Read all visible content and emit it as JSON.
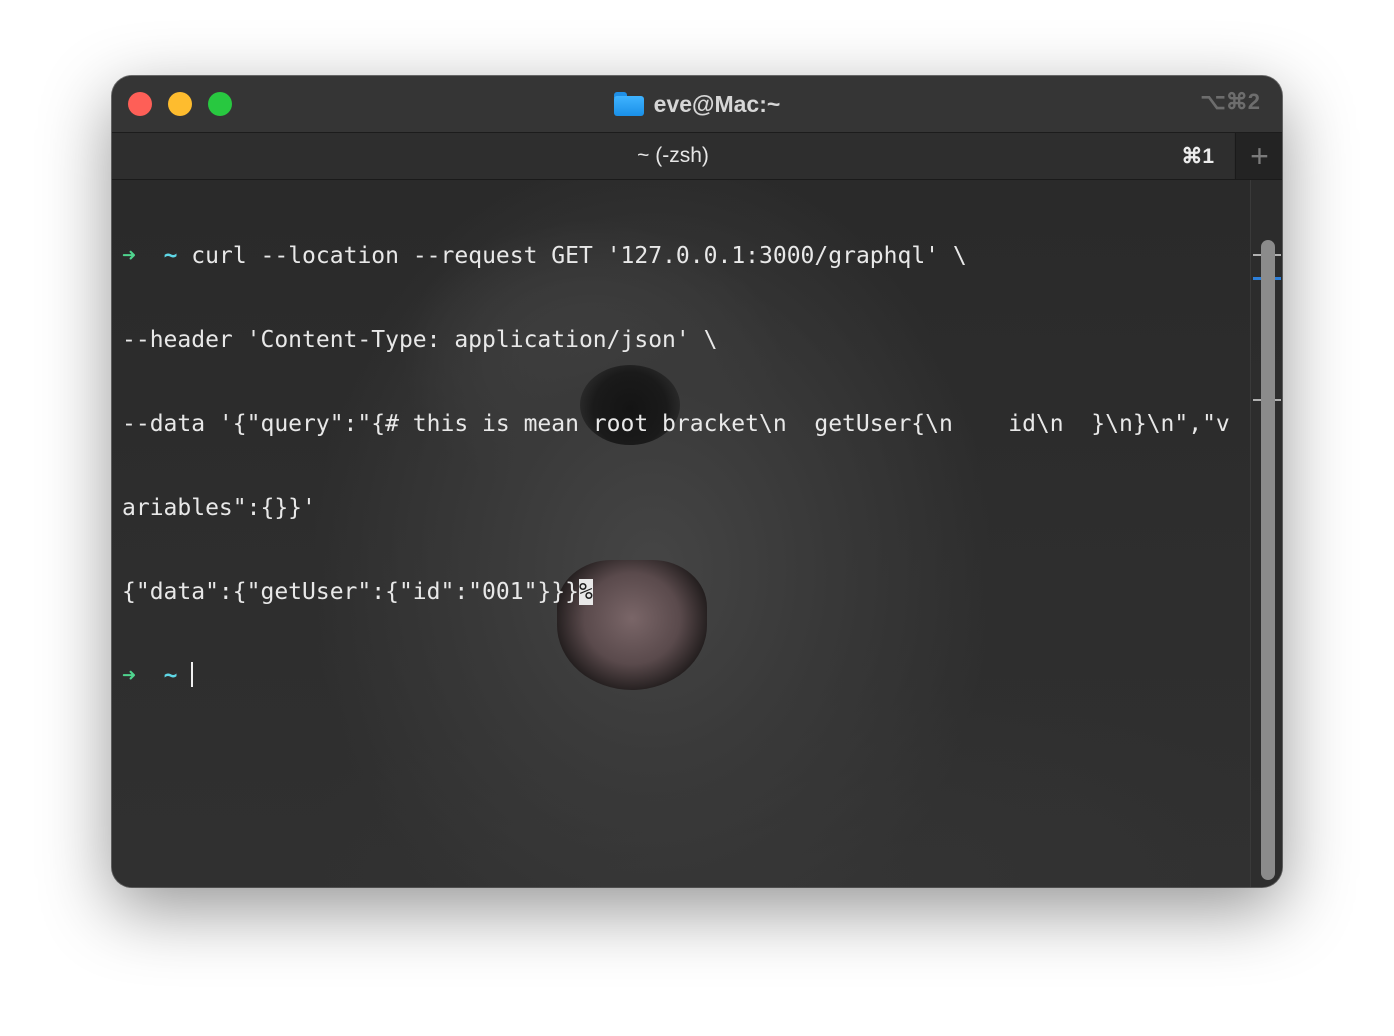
{
  "window": {
    "title": "eve@Mac:~",
    "title_icon": "folder-icon",
    "window_shortcut": "⌥⌘2"
  },
  "tabs": [
    {
      "label": "~ (-zsh)",
      "shortcut": "⌘1"
    }
  ],
  "new_tab_icon": "plus-icon",
  "terminal": {
    "prompt_symbol": "➜",
    "prompt_dir": "~",
    "command_line_1": "curl --location --request GET '127.0.0.1:3000/graphql' \\",
    "command_line_2": "--header 'Content-Type: application/json' \\",
    "command_line_3": "--data '{\"query\":\"{# this is mean root bracket\\n  getUser{\\n    id\\n  }\\n}\\n\",\"v",
    "command_line_4": "ariables\":{}}'",
    "output_line": "{\"data\":{\"getUser\":{\"id\":\"001\"}}}",
    "no_newline_mark": "%"
  },
  "colors": {
    "prompt_arrow": "#4fd48e",
    "prompt_dir": "#5fd7e6",
    "text": "#e8e8e8",
    "scroll_marker": "#2d7fd8"
  }
}
